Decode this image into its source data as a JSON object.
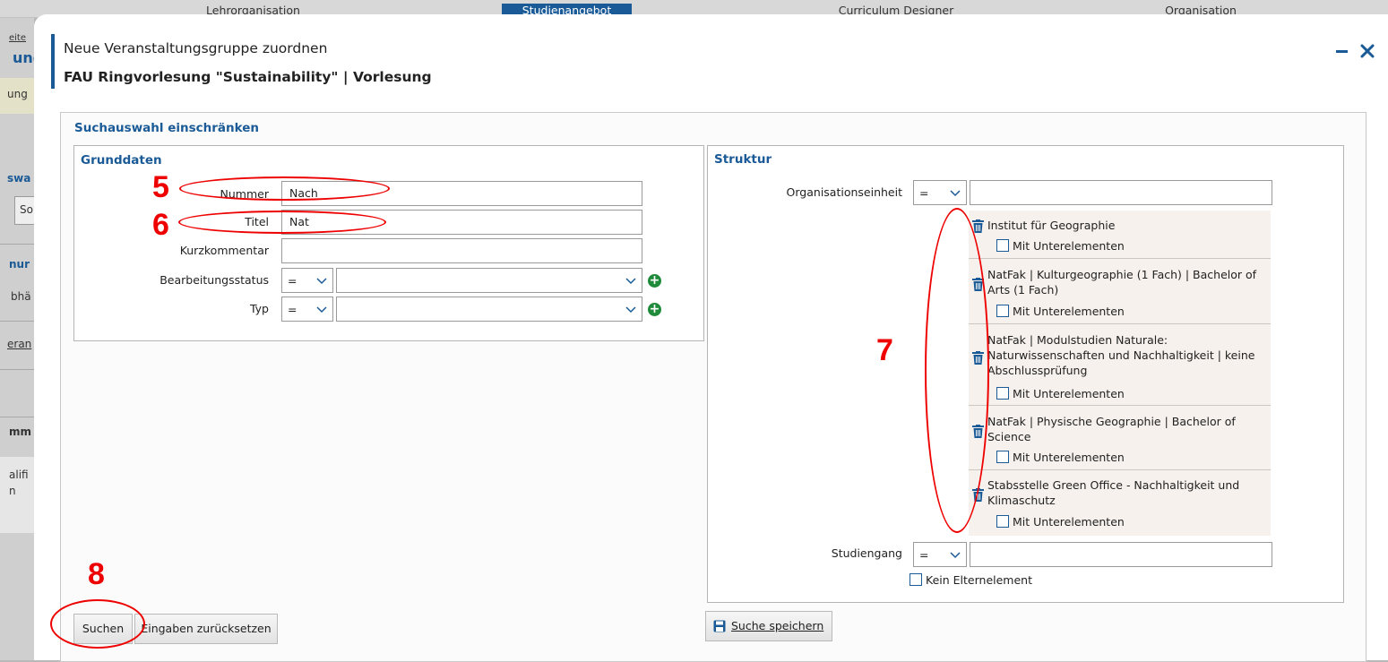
{
  "topnav": {
    "tabs": [
      "Lehrorganisation",
      "Studienangebot",
      "Curriculum Designer",
      "Organisation"
    ],
    "active_tab": "Studienangebot"
  },
  "background": {
    "fragments": [
      "eite",
      "ung",
      "ung",
      "swa",
      "So",
      "nur",
      "bhä",
      "eran",
      "mm",
      "alifi",
      "n"
    ]
  },
  "dialog": {
    "subtitle": "Neue Veranstaltungsgruppe zuordnen",
    "title": "FAU Ringvorlesung \"Sustainability\" | Vorlesung",
    "minimize_icon": "minus-icon",
    "close_icon": "close-icon",
    "accent_color": "#1a5a96"
  },
  "search": {
    "section_title": "Suchauswahl einschränken",
    "grunddaten": {
      "title": "Grunddaten",
      "nummer_label": "Nummer",
      "nummer_value": "Nach",
      "titel_label": "Titel",
      "titel_value": "Nat",
      "kurzkommentar_label": "Kurzkommentar",
      "kurzkommentar_value": "",
      "bearbeitungsstatus_label": "Bearbeitungsstatus",
      "bearbeitungsstatus_operator": "=",
      "bearbeitungsstatus_value": "",
      "typ_label": "Typ",
      "typ_operator": "=",
      "typ_value": ""
    },
    "struktur": {
      "title": "Struktur",
      "orgeinheit_label": "Organisationseinheit",
      "orgeinheit_operator": "=",
      "orgeinheit_value": "",
      "org_items": [
        {
          "name": "Institut für Geographie",
          "sub_label": "Mit Unterelementen",
          "checked": false
        },
        {
          "name": "NatFak | Kulturgeographie (1 Fach) | Bachelor of Arts (1 Fach)",
          "sub_label": "Mit Unterelementen",
          "checked": false
        },
        {
          "name": "NatFak | Modulstudien Naturale: Naturwissenschaften und Nachhaltigkeit | keine Abschlussprüfung",
          "sub_label": "Mit Unterelementen",
          "checked": false
        },
        {
          "name": "NatFak | Physische Geographie | Bachelor of Science",
          "sub_label": "Mit Unterelementen",
          "checked": false
        },
        {
          "name": "Stabsstelle Green Office - Nachhaltigkeit und Klimaschutz",
          "sub_label": "Mit Unterelementen",
          "checked": false
        }
      ],
      "studiengang_label": "Studiengang",
      "studiengang_operator": "=",
      "studiengang_value": "",
      "kein_eltern_label": "Kein Elternelement",
      "kein_eltern_checked": false
    },
    "buttons": {
      "suchen": "Suchen",
      "reset": "Eingaben zurücksetzen",
      "save_search": "Suche speichern"
    }
  },
  "annotations": {
    "numbers": [
      "5",
      "6",
      "7",
      "8"
    ],
    "color": "#e00000"
  }
}
